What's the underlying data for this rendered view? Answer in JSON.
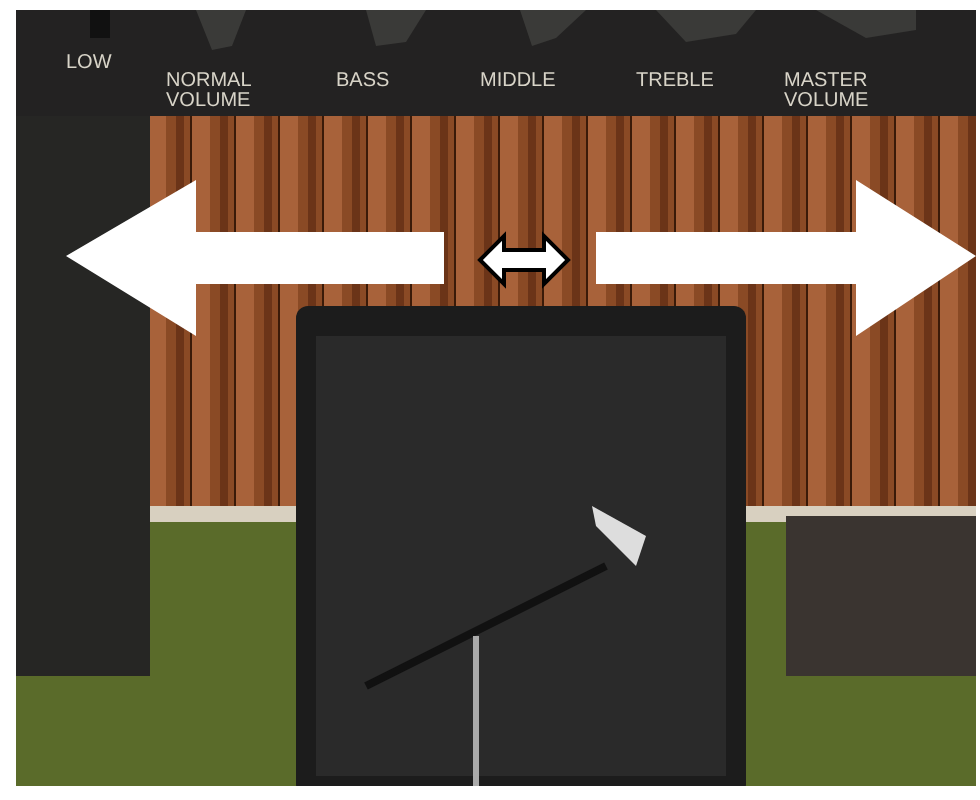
{
  "control_panel": {
    "labels": [
      {
        "text": "LOW"
      },
      {
        "text": "NORMAL\nVOLUME"
      },
      {
        "text": "BASS"
      },
      {
        "text": "MIDDLE"
      },
      {
        "text": "TREBLE"
      },
      {
        "text": "MASTER\nVOLUME"
      }
    ]
  }
}
